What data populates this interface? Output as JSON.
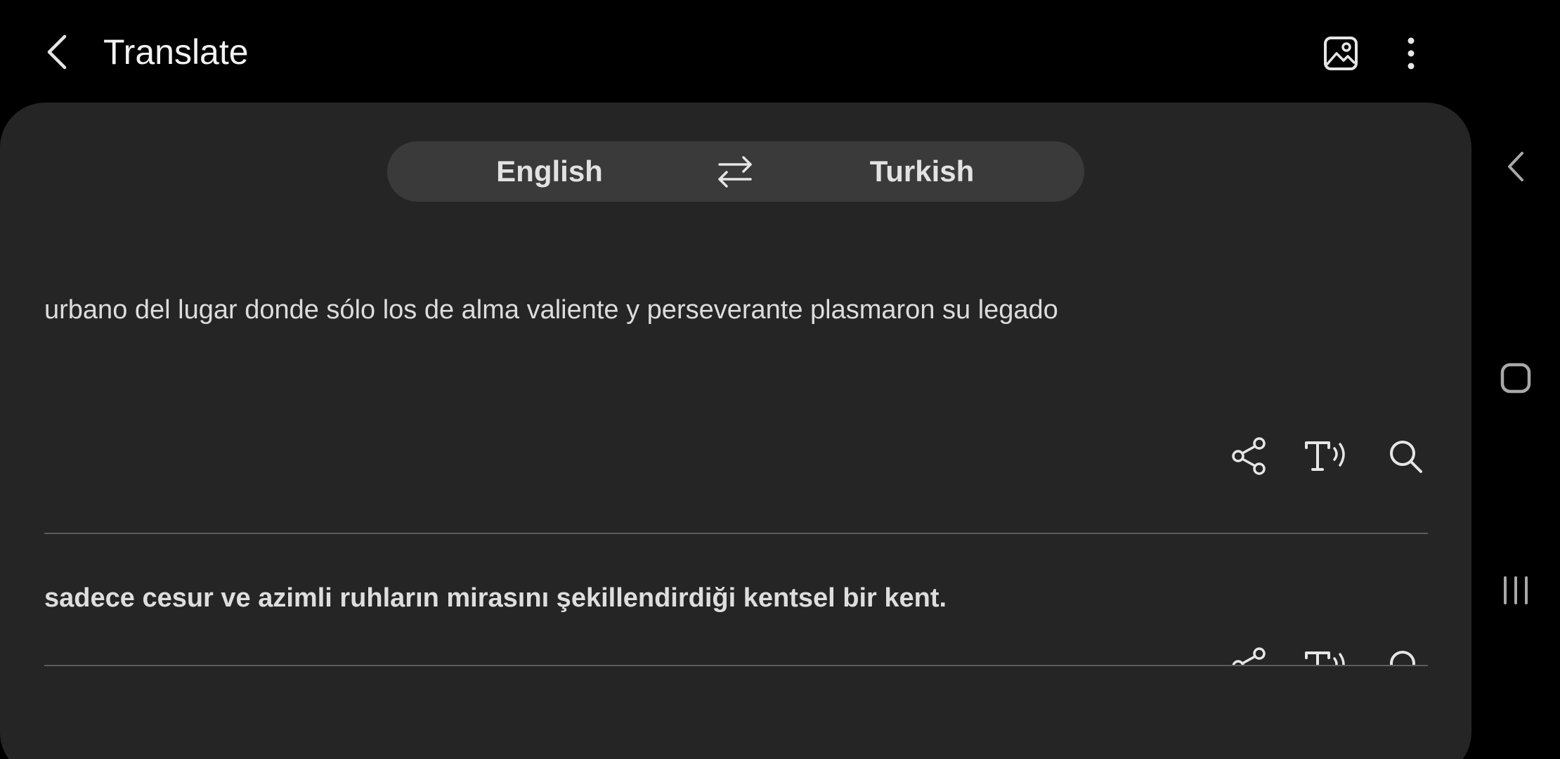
{
  "appbar": {
    "title": "Translate",
    "back_icon": "chevron-left-icon",
    "image_icon": "image-icon",
    "more_icon": "more-vertical-icon"
  },
  "languages": {
    "source": "English",
    "target": "Turkish",
    "swap_icon": "swap-arrows-icon"
  },
  "source_panel": {
    "text": "urbano del lugar donde sólo los de alma valiente y perseverante plasmaron su legado",
    "actions": [
      "share-icon",
      "text-to-speech-icon",
      "search-icon"
    ]
  },
  "target_panel": {
    "text": "sadece cesur ve azimli ruhların mirasını şekillendirdiği kentsel bir kent.",
    "actions": [
      "share-icon",
      "text-to-speech-icon",
      "search-icon"
    ]
  },
  "navbar": {
    "items": [
      "back-icon",
      "home-icon",
      "recents-icon"
    ]
  },
  "colors": {
    "background": "#000000",
    "card": "#252525",
    "pill": "#3a3a3a",
    "text": "#e6e6e6",
    "divider": "#5c5c5c"
  }
}
